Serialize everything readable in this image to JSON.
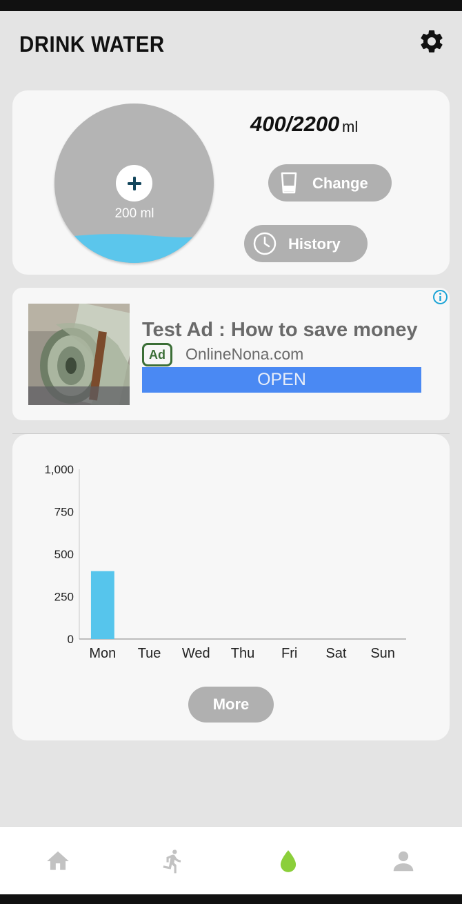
{
  "header": {
    "title": "DRINK WATER",
    "settings_icon": "gear-icon"
  },
  "intake": {
    "progress": "400/2200",
    "unit": "ml",
    "cup_size": "200 ml",
    "fill_fraction": 0.18,
    "water_color": "#5bc6ec",
    "change_label": "Change",
    "history_label": "History"
  },
  "ad": {
    "title": "Test Ad : How to save money",
    "badge": "Ad",
    "domain": "OnlineNona.com",
    "cta": "OPEN",
    "cta_color": "#4a89f3"
  },
  "chart_data": {
    "type": "bar",
    "categories": [
      "Mon",
      "Tue",
      "Wed",
      "Thu",
      "Fri",
      "Sat",
      "Sun"
    ],
    "values": [
      400,
      0,
      0,
      0,
      0,
      0,
      0
    ],
    "ylim": [
      0,
      1000
    ],
    "yticks": [
      0,
      250,
      500,
      750,
      1000
    ],
    "ytick_labels": [
      "0",
      "250",
      "500",
      "750",
      "1,000"
    ],
    "bar_color": "#56c5ec",
    "grid": false
  },
  "more_label": "More",
  "nav": {
    "items": [
      {
        "icon": "home-icon",
        "active": false
      },
      {
        "icon": "running-icon",
        "active": false
      },
      {
        "icon": "water-drop-icon",
        "active": true
      },
      {
        "icon": "profile-icon",
        "active": false
      }
    ],
    "active_color": "#8bcf3a",
    "inactive_color": "#c2c2c2"
  }
}
